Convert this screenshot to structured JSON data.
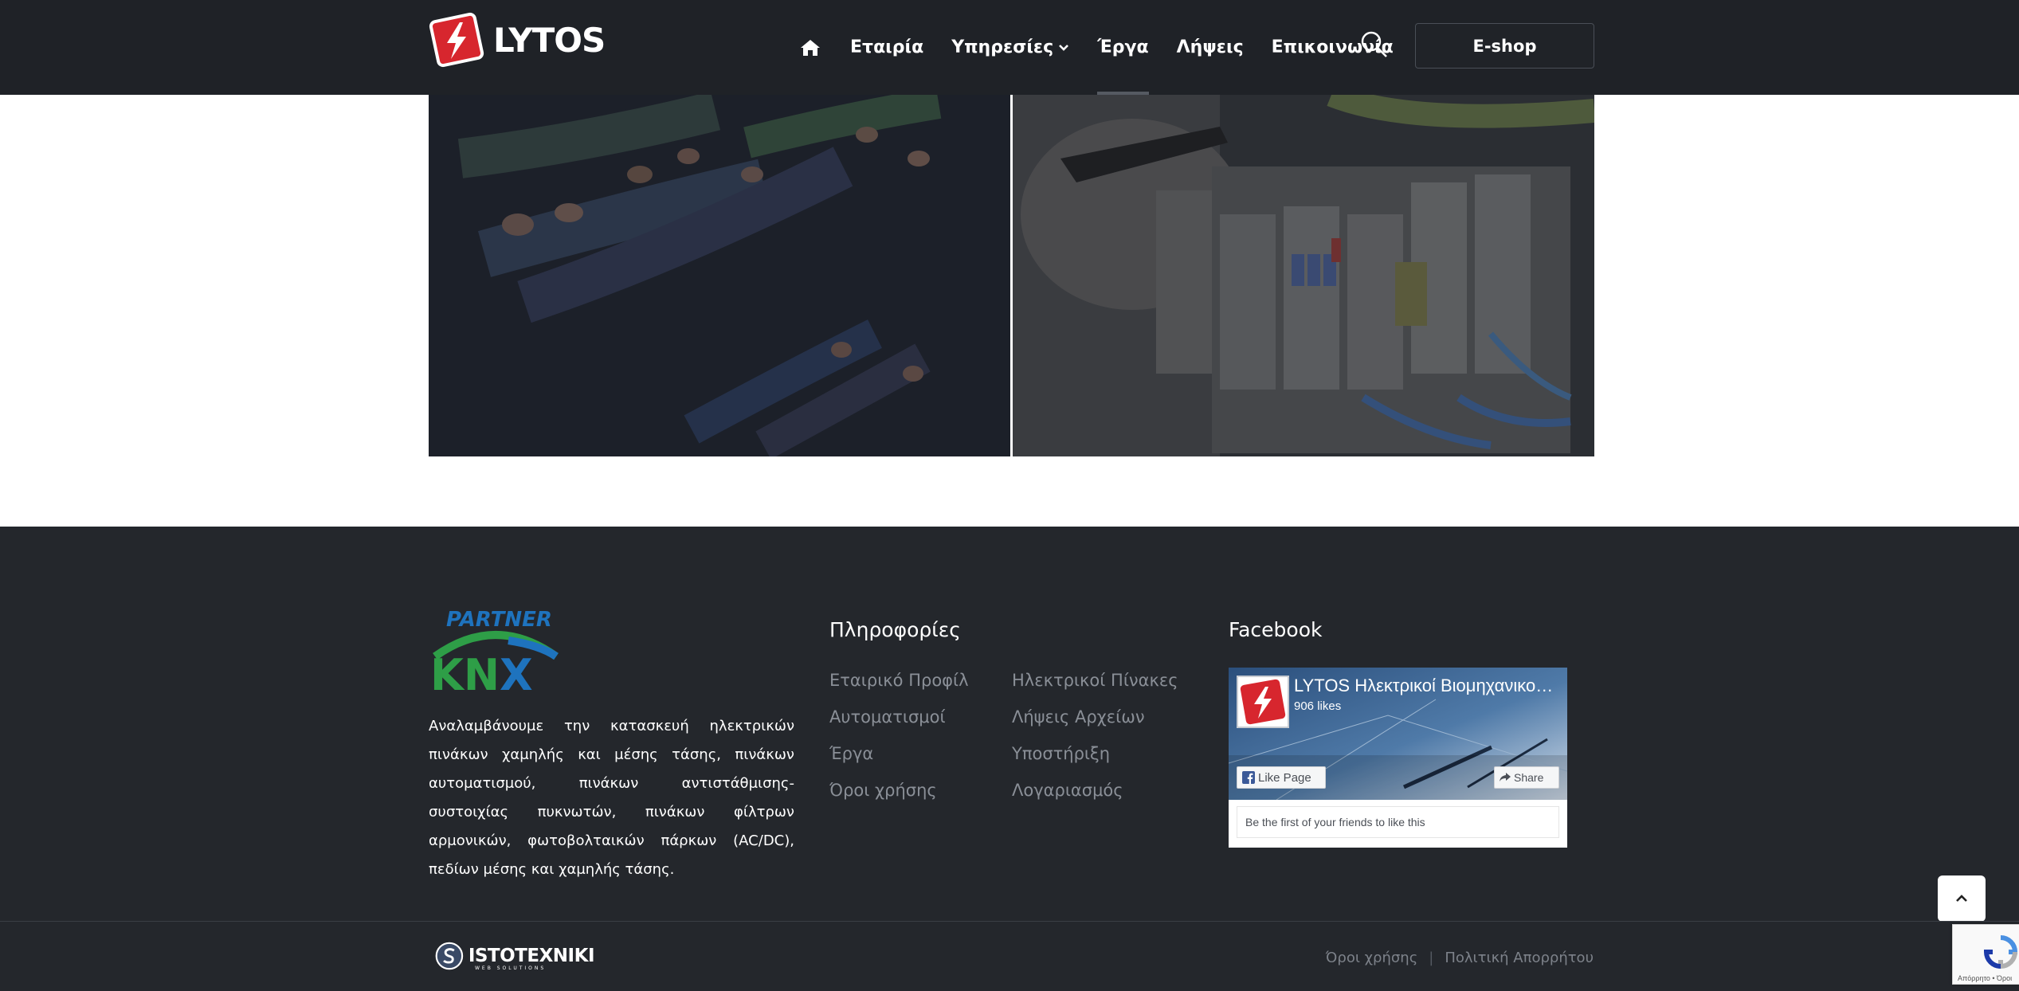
{
  "header": {
    "logo_text": "LYTOS",
    "nav": [
      {
        "label": "Εταιρία"
      },
      {
        "label": "Υπηρεσίες"
      },
      {
        "label": "Έργα"
      },
      {
        "label": "Λήψεις"
      },
      {
        "label": "Επικοινωνία"
      }
    ],
    "eshop_label": "E-shop"
  },
  "footer": {
    "about_text": "Αναλαμβάνουμε την κατασκευή ηλεκτρικών πινάκων χαμηλής και μέσης τάσης, πινάκων αυτοματισμού, πινάκων αντιστάθμισης-συστοιχίας πυκνωτών, πινάκων φίλτρων αρμονικών, φωτοβολταικών πάρκων (AC/DC), πεδίων μέσης και χαμηλής τάσης.",
    "knx": {
      "top": "PARTNER",
      "bottom": "KNX"
    },
    "info_title": "Πληροφορίες",
    "info_links_col1": [
      "Εταιρικό Προφίλ",
      "Αυτοματισμοί",
      "Έργα",
      "Όροι χρήσης"
    ],
    "info_links_col2": [
      "Ηλεκτρικοί Πίνακες",
      "Λήψεις Αρχείων",
      "Υποστήριξη",
      "Λογαριασμός"
    ],
    "facebook_title": "Facebook",
    "facebook": {
      "page_name": "LYTOS Ηλεκτρικοί Βιομηχανικοί Πίνακες",
      "likes": "906 likes",
      "like_button": "Like Page",
      "share_button": "Share",
      "friends_text": "Be the first of your friends to like this"
    },
    "credit_logo_text": "ISTOTEXNIKI",
    "credit_logo_sub": "WEB SOLUTIONS",
    "legal_links": [
      "Όροι χρήσης",
      "Πολιτική Απορρήτου"
    ],
    "recaptcha_terms": "Απόρρητο • Όροι"
  },
  "colors": {
    "header_bg": "#1f2227",
    "footer_bg": "#24272c",
    "brand_red": "#d7262e",
    "knx_green": "#2e9e47",
    "knx_blue": "#1e73be"
  }
}
